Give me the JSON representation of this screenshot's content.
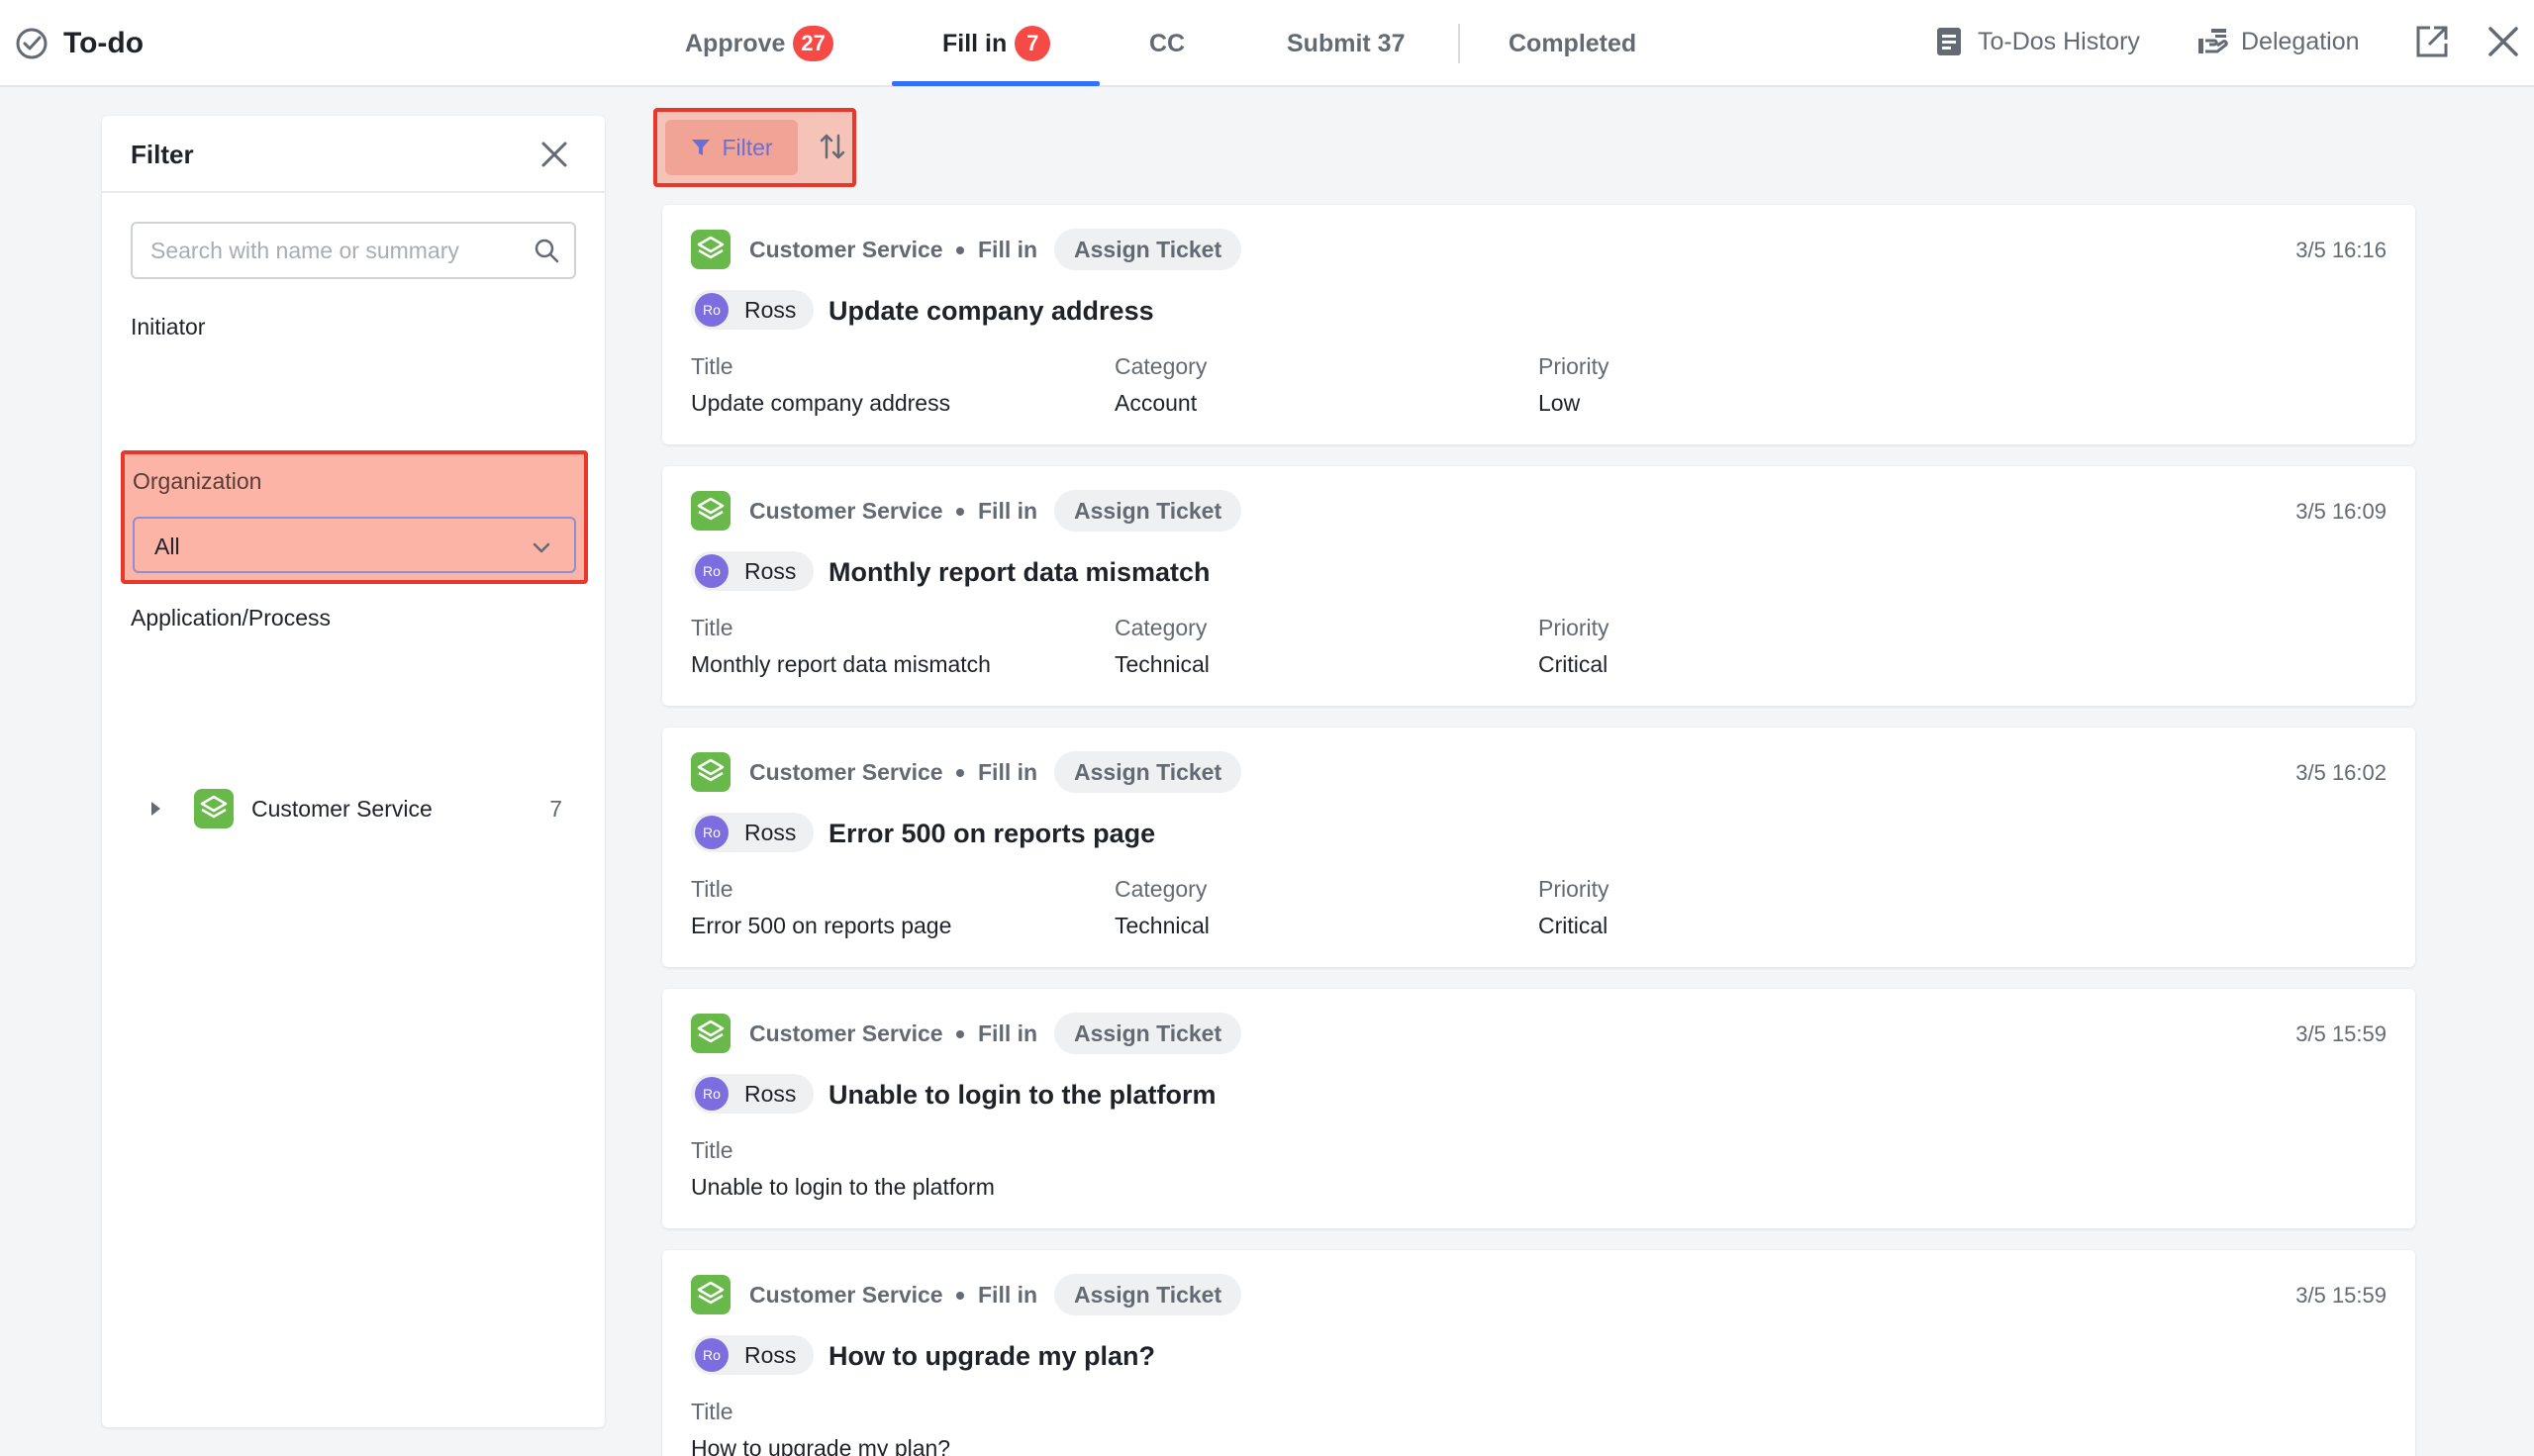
{
  "header": {
    "title": "To-do",
    "tabs": [
      {
        "label": "Approve",
        "badge": "27"
      },
      {
        "label": "Fill in",
        "badge": "7"
      },
      {
        "label": "CC"
      },
      {
        "label": "Submit 37"
      },
      {
        "label": "Completed"
      }
    ],
    "history_label": "To-Dos History",
    "delegation_label": "Delegation"
  },
  "filter": {
    "title": "Filter",
    "search_placeholder": "Search with name or summary",
    "initiator_label": "Initiator",
    "organization_label": "Organization",
    "organization_value": "All",
    "app_process_label": "Application/Process",
    "tree": [
      {
        "label": "Customer Service",
        "count": "7"
      }
    ]
  },
  "toolbar": {
    "filter_label": "Filter"
  },
  "colors": {
    "accent": "#3370ff",
    "badge": "#f54a45",
    "app_icon": "#68b84a",
    "avatar": "#7d6ee0",
    "highlight": "#e8372b"
  },
  "cards": [
    {
      "app": "Customer Service",
      "action": "Fill in",
      "tag": "Assign Ticket",
      "time": "3/5 16:16",
      "avatar": "Ro",
      "user": "Ross",
      "title": "Update company address",
      "fields": [
        {
          "label": "Title",
          "value": "Update company address"
        },
        {
          "label": "Category",
          "value": "Account"
        },
        {
          "label": "Priority",
          "value": "Low"
        }
      ]
    },
    {
      "app": "Customer Service",
      "action": "Fill in",
      "tag": "Assign Ticket",
      "time": "3/5 16:09",
      "avatar": "Ro",
      "user": "Ross",
      "title": "Monthly report data mismatch",
      "fields": [
        {
          "label": "Title",
          "value": "Monthly report data mismatch"
        },
        {
          "label": "Category",
          "value": "Technical"
        },
        {
          "label": "Priority",
          "value": "Critical"
        }
      ]
    },
    {
      "app": "Customer Service",
      "action": "Fill in",
      "tag": "Assign Ticket",
      "time": "3/5 16:02",
      "avatar": "Ro",
      "user": "Ross",
      "title": "Error 500 on reports page",
      "fields": [
        {
          "label": "Title",
          "value": "Error 500 on reports page"
        },
        {
          "label": "Category",
          "value": "Technical"
        },
        {
          "label": "Priority",
          "value": "Critical"
        }
      ]
    },
    {
      "app": "Customer Service",
      "action": "Fill in",
      "tag": "Assign Ticket",
      "time": "3/5 15:59",
      "avatar": "Ro",
      "user": "Ross",
      "title": "Unable to login to the platform",
      "fields": [
        {
          "label": "Title",
          "value": "Unable to login to the platform"
        }
      ]
    },
    {
      "app": "Customer Service",
      "action": "Fill in",
      "tag": "Assign Ticket",
      "time": "3/5 15:59",
      "avatar": "Ro",
      "user": "Ross",
      "title": "How to upgrade my plan?",
      "fields": [
        {
          "label": "Title",
          "value": "How to upgrade my plan?"
        }
      ]
    }
  ]
}
